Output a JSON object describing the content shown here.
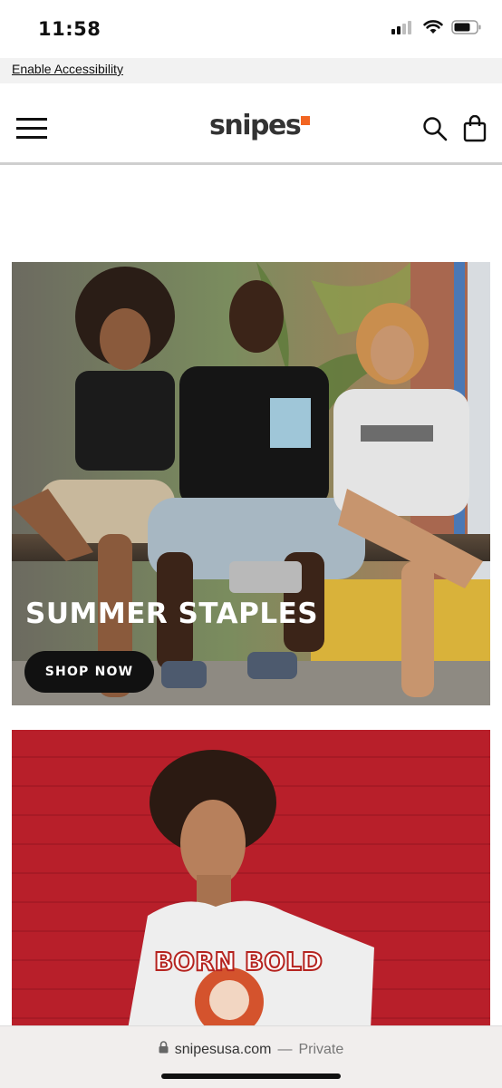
{
  "status_bar": {
    "time": "11:58",
    "icons": [
      "cellular-signal-icon",
      "wifi-icon",
      "battery-icon"
    ]
  },
  "accessibility": {
    "link_label": "Enable Accessibility"
  },
  "header": {
    "logo_text": "snipes",
    "logo_accent_color": "#f26522",
    "icons": [
      "hamburger-menu-icon",
      "search-icon",
      "shopping-bag-icon"
    ]
  },
  "hero_banners": [
    {
      "title": "SUMMER STAPLES",
      "cta_label": "SHOP NOW",
      "image_description_icon": "summer-staples-photo"
    },
    {
      "image_description_icon": "born-bold-tee-photo",
      "background_color": "#b81f2a"
    }
  ],
  "browser": {
    "domain": "snipesusa.com",
    "separator": "—",
    "mode": "Private",
    "icons": [
      "lock-icon"
    ]
  }
}
